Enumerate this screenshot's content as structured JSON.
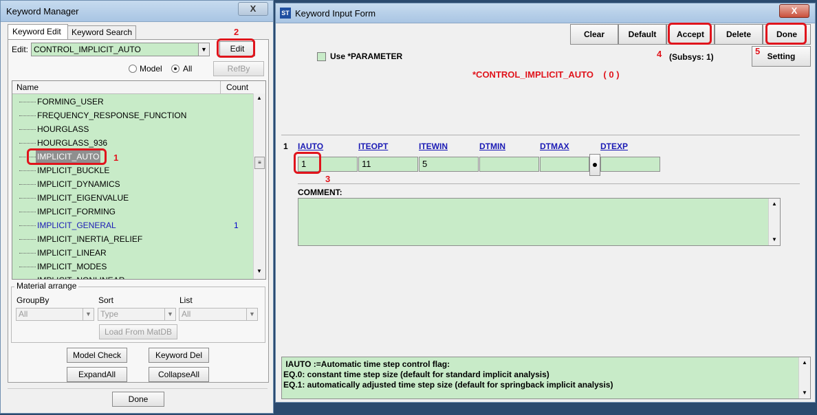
{
  "keyword_manager": {
    "title": "Keyword Manager",
    "close_label": "X",
    "tabs": [
      "Keyword Edit",
      "Keyword Search"
    ],
    "edit_label": "Edit:",
    "edit_value": "CONTROL_IMPLICIT_AUTO",
    "edit_button": "Edit",
    "radio_model": "Model",
    "radio_all": "All",
    "refby_button": "RefBy",
    "columns": {
      "name": "Name",
      "count": "Count"
    },
    "items": [
      {
        "label": "FORMING_USER",
        "count": ""
      },
      {
        "label": "FREQUENCY_RESPONSE_FUNCTION",
        "count": ""
      },
      {
        "label": "HOURGLASS",
        "count": ""
      },
      {
        "label": "HOURGLASS_936",
        "count": ""
      },
      {
        "label": "IMPLICIT_AUTO",
        "count": ""
      },
      {
        "label": "IMPLICIT_BUCKLE",
        "count": ""
      },
      {
        "label": "IMPLICIT_DYNAMICS",
        "count": ""
      },
      {
        "label": "IMPLICIT_EIGENVALUE",
        "count": ""
      },
      {
        "label": "IMPLICIT_FORMING",
        "count": ""
      },
      {
        "label": "IMPLICIT_GENERAL",
        "count": "1"
      },
      {
        "label": "IMPLICIT_INERTIA_RELIEF",
        "count": ""
      },
      {
        "label": "IMPLICIT_LINEAR",
        "count": ""
      },
      {
        "label": "IMPLICIT_MODES",
        "count": ""
      },
      {
        "label": "IMPLICIT_NONLINEAR",
        "count": ""
      }
    ],
    "material_arrange": {
      "title": "Material arrange",
      "groupby_label": "GroupBy",
      "groupby_value": "All",
      "sort_label": "Sort",
      "sort_value": "Type",
      "list_label": "List",
      "list_value": "All",
      "load_button": "Load From MatDB"
    },
    "model_check": "Model Check",
    "keyword_del": "Keyword Del",
    "expand_all": "ExpandAll",
    "collapse_all": "CollapseAll",
    "done": "Done"
  },
  "input_form": {
    "title": "Keyword Input Form",
    "close_label": "X",
    "buttons": {
      "clear": "Clear",
      "default": "Default",
      "accept": "Accept",
      "delete": "Delete",
      "done": "Done",
      "setting": "Setting"
    },
    "use_parameter": "Use *PARAMETER",
    "subsys": "(Subsys: 1)",
    "keyword_title": "*CONTROL_IMPLICIT_AUTO    ( 0 )",
    "card_number": "1",
    "fields": [
      {
        "label": "IAUTO",
        "value": "1"
      },
      {
        "label": "ITEOPT",
        "value": "11"
      },
      {
        "label": "ITEWIN",
        "value": "5"
      },
      {
        "label": "DTMIN",
        "value": ""
      },
      {
        "label": "DTMAX",
        "value": ""
      },
      {
        "label": "DTEXP",
        "value": ""
      }
    ],
    "comment_label": "COMMENT:",
    "help_lines": [
      " IAUTO :=Automatic time step control flag:",
      "EQ.0: constant time step size (default for standard implicit analysis)",
      "EQ.1: automatically adjusted time step size (default for springback implicit analysis)"
    ]
  },
  "annotations": [
    "1",
    "2",
    "3",
    "4",
    "5"
  ],
  "colors": {
    "field_green": "#c8ebc8",
    "annotation_red": "#e0141c",
    "keyword_red": "#e0141c",
    "link_blue": "#1a1ab5"
  }
}
